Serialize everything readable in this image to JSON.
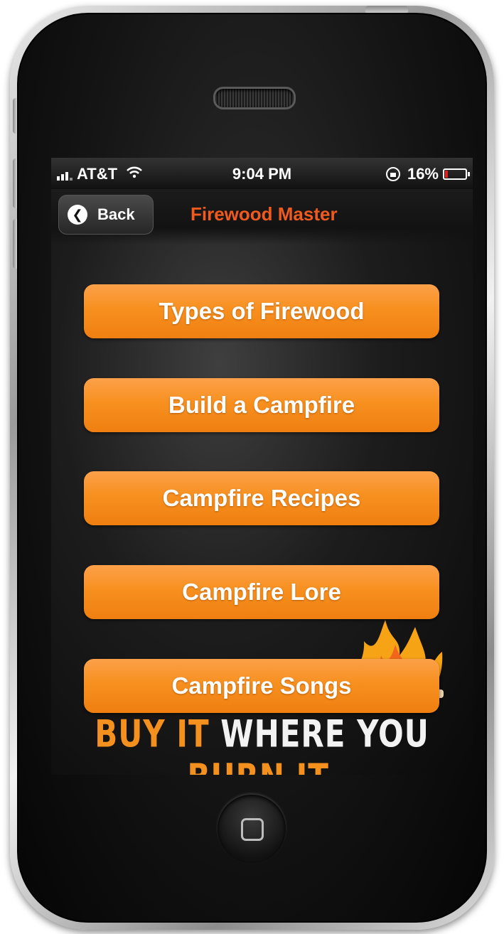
{
  "status_bar": {
    "carrier": "AT&T",
    "time": "9:04 PM",
    "battery_percent": "16%",
    "battery_level": 0.16,
    "signal_icon": "signal-bars-icon",
    "wifi_icon": "wifi-icon",
    "rotation_lock_icon": "rotation-lock-icon",
    "battery_icon": "battery-icon"
  },
  "nav": {
    "back_label": "Back",
    "title": "Firewood Master",
    "title_color": "#f05a1e"
  },
  "menu": {
    "items": [
      {
        "label": "Types of Firewood"
      },
      {
        "label": "Build a Campfire"
      },
      {
        "label": "Campfire Recipes"
      },
      {
        "label": "Campfire Lore"
      },
      {
        "label": "Campfire Songs"
      }
    ],
    "button_color": "#f7901f"
  },
  "slogan": {
    "part1": "BUY IT ",
    "part2": "WHERE YOU ",
    "part3": "BURN IT."
  }
}
